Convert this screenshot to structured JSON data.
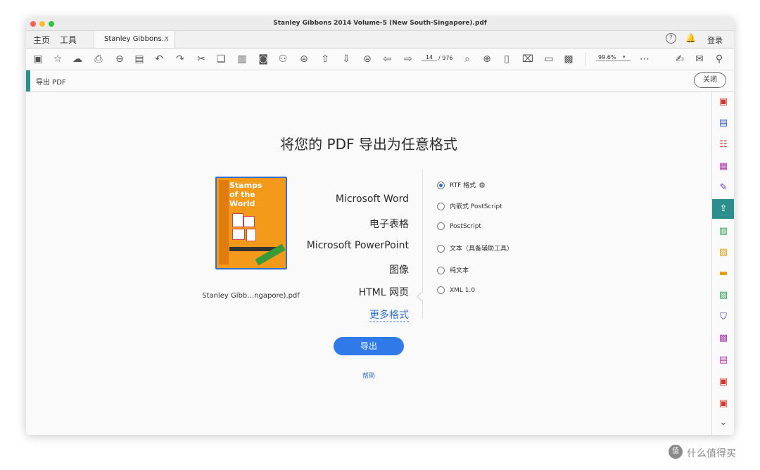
{
  "window": {
    "title": "Stanley Gibbons 2014 Volume-5 (New South-Singapore).pdf"
  },
  "tabs": {
    "home": "主页",
    "tools": "工具",
    "doc_tab": "Stanley Gibbons...",
    "close_glyph": "×",
    "login": "登录"
  },
  "toolbar": {
    "page_current": "14",
    "page_total": "/ 976",
    "zoom": "99.6%"
  },
  "panel": {
    "title": "导出 PDF",
    "close_label": "关闭"
  },
  "main": {
    "heading": "将您的 PDF 导出为任意格式",
    "filename": "Stanley Gibb…ngapore).pdf",
    "cover_title": "Stamps of the World",
    "categories": [
      "Microsoft Word",
      "电子表格",
      "Microsoft PowerPoint",
      "图像",
      "HTML 网页",
      "更多格式"
    ],
    "selected_category": "更多格式",
    "options": [
      "RTF 格式",
      "内嵌式 PostScript",
      "PostScript",
      "文本（具备辅助工具）",
      "纯文本",
      "XML 1.0"
    ],
    "selected_option": "RTF 格式",
    "export_label": "导出",
    "help_label": "帮助"
  },
  "watermark": {
    "text": "什么值得买",
    "icon": "值"
  },
  "colors": {
    "accent": "#2d8e8e",
    "primary": "#2f7ae8"
  }
}
